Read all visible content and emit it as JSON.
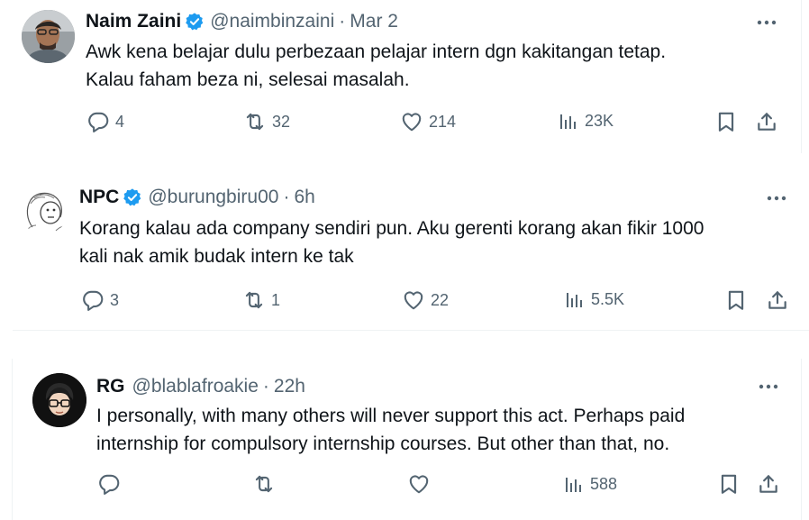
{
  "colors": {
    "verified": "#1d9bf0",
    "muted": "#536471",
    "text": "#0f1419",
    "divider": "#eff3f4"
  },
  "tweets": [
    {
      "name": "Naim Zaini",
      "handle": "@naimbinzaini",
      "separator": "·",
      "time": "Mar 2",
      "verified": true,
      "text_lines": [
        "Awk kena belajar dulu perbezaan pelajar intern dgn kakitangan tetap.",
        "Kalau faham beza ni, selesai masalah."
      ],
      "counts": {
        "replies": "4",
        "retweets": "32",
        "likes": "214",
        "views": "23K"
      }
    },
    {
      "name": "NPC",
      "handle": "@burungbiru00",
      "separator": "·",
      "time": "6h",
      "verified": true,
      "text_lines": [
        "Korang kalau ada company sendiri pun. Aku gerenti korang akan fikir 1000",
        "kali nak amik budak intern ke tak"
      ],
      "counts": {
        "replies": "3",
        "retweets": "1",
        "likes": "22",
        "views": "5.5K"
      }
    },
    {
      "name": "RG",
      "handle": "@blablafroakie",
      "separator": "·",
      "time": "22h",
      "verified": false,
      "text_lines": [
        "I personally, with many others will never support this act. Perhaps paid",
        "internship for compulsory internship courses. But other than that, no."
      ],
      "counts": {
        "replies": "",
        "retweets": "",
        "likes": "",
        "views": "588"
      }
    }
  ],
  "icons": {
    "reply": "reply-icon",
    "retweet": "retweet-icon",
    "like": "heart-icon",
    "views": "views-icon",
    "bookmark": "bookmark-icon",
    "share": "share-icon",
    "more": "more-icon",
    "verified": "verified-badge-icon"
  }
}
